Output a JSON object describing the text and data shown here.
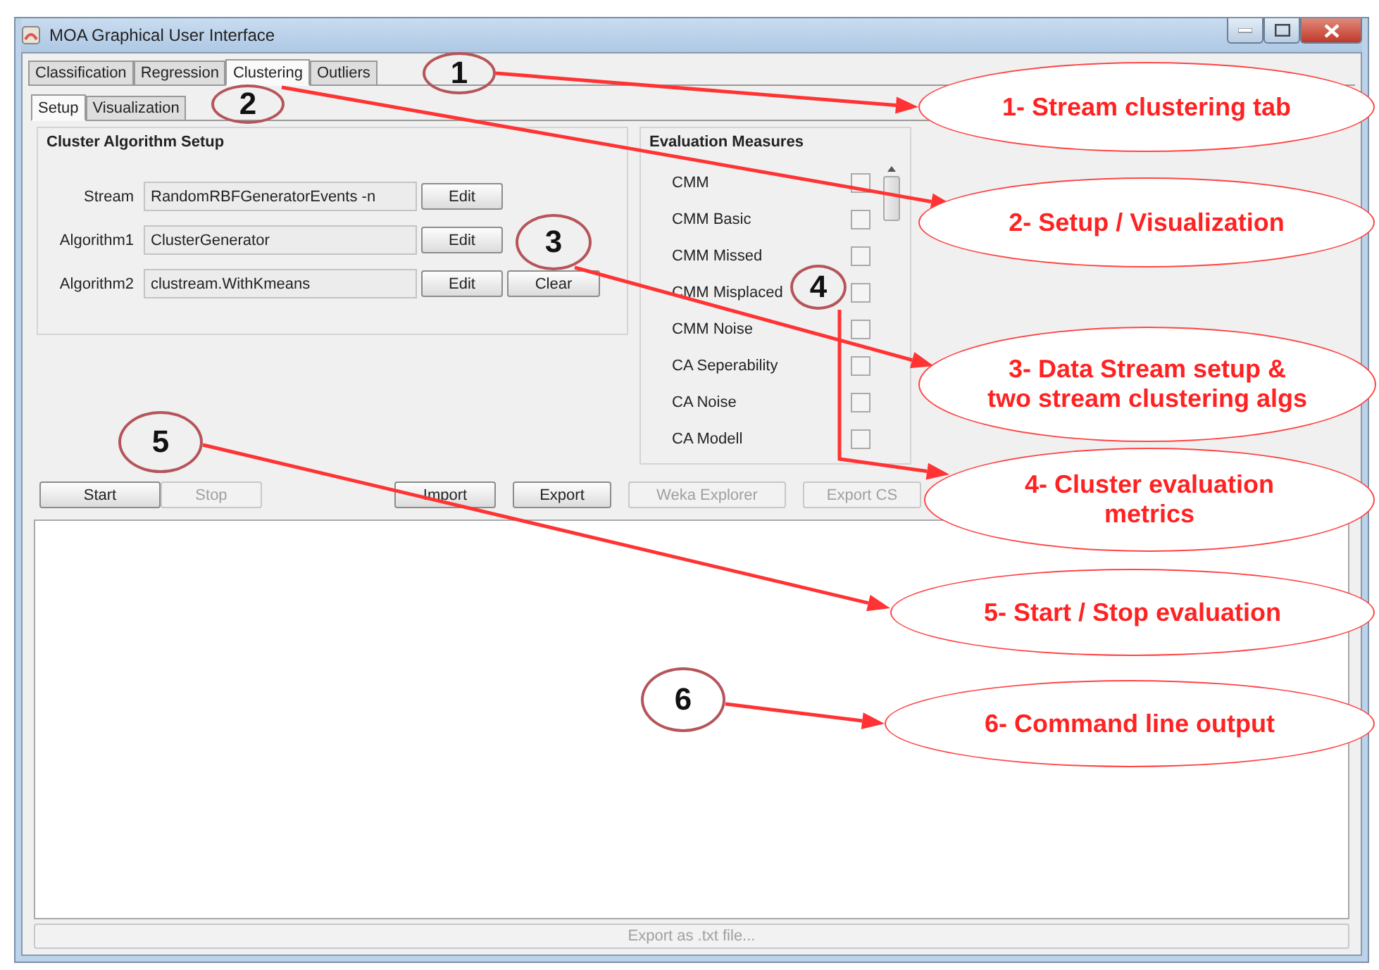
{
  "window": {
    "title": "MOA Graphical User Interface"
  },
  "tabs": [
    {
      "label": "Classification",
      "selected": false
    },
    {
      "label": "Regression",
      "selected": false
    },
    {
      "label": "Clustering",
      "selected": true
    },
    {
      "label": "Outliers",
      "selected": false
    }
  ],
  "subtabs": [
    {
      "label": "Setup",
      "selected": true
    },
    {
      "label": "Visualization",
      "selected": false
    }
  ],
  "setup": {
    "title": "Cluster Algorithm Setup",
    "rows": [
      {
        "label": "Stream",
        "value": "RandomRBFGeneratorEvents -n",
        "buttons": [
          "Edit"
        ]
      },
      {
        "label": "Algorithm1",
        "value": "ClusterGenerator",
        "buttons": [
          "Edit"
        ]
      },
      {
        "label": "Algorithm2",
        "value": "clustream.WithKmeans",
        "buttons": [
          "Edit",
          "Clear"
        ]
      }
    ]
  },
  "evaluation": {
    "title": "Evaluation Measures",
    "measures": [
      {
        "label": "CMM",
        "checked": false
      },
      {
        "label": "CMM Basic",
        "checked": false
      },
      {
        "label": "CMM Missed",
        "checked": false
      },
      {
        "label": "CMM Misplaced",
        "checked": false
      },
      {
        "label": "CMM Noise",
        "checked": false
      },
      {
        "label": "CA Seperability",
        "checked": false
      },
      {
        "label": "CA Noise",
        "checked": false
      },
      {
        "label": "CA Modell",
        "checked": false
      }
    ]
  },
  "actions": [
    {
      "label": "Start",
      "disabled": false
    },
    {
      "label": "Stop",
      "disabled": true
    },
    {
      "label": "Import",
      "disabled": false
    },
    {
      "label": "Export",
      "disabled": false
    },
    {
      "label": "Weka Explorer",
      "disabled": true
    },
    {
      "label": "Export CS",
      "disabled": true
    }
  ],
  "export_button": {
    "label": "Export as .txt file...",
    "disabled": true
  },
  "annotations": [
    {
      "number": "1",
      "callout": [
        "1- Stream clustering tab"
      ]
    },
    {
      "number": "2",
      "callout": [
        "2- Setup / Visualization"
      ]
    },
    {
      "number": "3",
      "callout": [
        "3- Data Stream setup &",
        "two stream clustering algs"
      ]
    },
    {
      "number": "4",
      "callout": [
        "4- Cluster evaluation",
        "metrics"
      ]
    },
    {
      "number": "5",
      "callout": [
        "5- Start / Stop evaluation"
      ]
    },
    {
      "number": "6",
      "callout": [
        "6- Command line output"
      ]
    }
  ]
}
